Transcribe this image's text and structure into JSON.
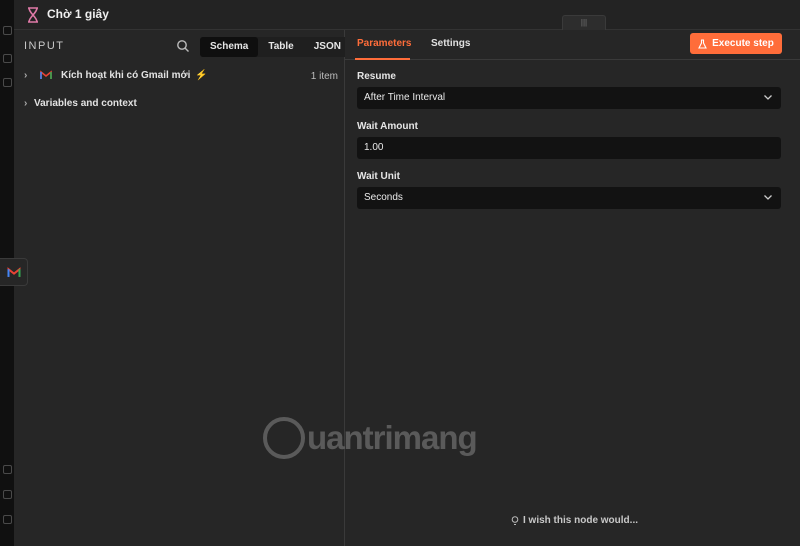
{
  "title": "Chờ 1 giây",
  "input_panel": {
    "heading": "INPUT",
    "view_tabs": [
      "Schema",
      "Table",
      "JSON"
    ],
    "active_view": "Schema",
    "trigger_node": "Kích hoạt khi có Gmail mới",
    "item_count": "1 item",
    "variables_label": "Variables and context"
  },
  "params_panel": {
    "tabs": [
      "Parameters",
      "Settings"
    ],
    "active_tab": "Parameters",
    "execute_label": "Execute step",
    "resume_label": "Resume",
    "resume_value": "After Time Interval",
    "wait_amount_label": "Wait Amount",
    "wait_amount_value": "1.00",
    "wait_unit_label": "Wait Unit",
    "wait_unit_value": "Seconds",
    "feedback_link": "I wish this node would..."
  },
  "watermark": "uantrimang",
  "colors": {
    "accent": "#ff6d3a",
    "panel_bg": "#262626",
    "field_bg": "#121212"
  },
  "icons": [
    "hourglass-icon",
    "search-icon",
    "gmail-icon",
    "bolt-icon",
    "chevron-right-icon",
    "chevron-down-icon",
    "flask-icon",
    "lightbulb-icon",
    "drag-handle-icon"
  ]
}
